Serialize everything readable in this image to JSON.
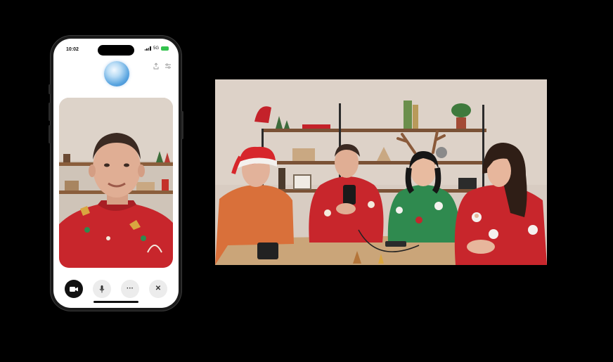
{
  "phone": {
    "status_time": "10:02",
    "network": "5G",
    "icons": {
      "share": "share-icon",
      "settings": "sliders-icon",
      "orb": "assistant-orb-icon"
    },
    "controls": {
      "camera": "video-camera-icon",
      "mic": "microphone-icon",
      "more": "more-icon",
      "more_label": "···",
      "close": "close-icon",
      "close_label": "✕"
    },
    "accent_orb": "#5aa5e0",
    "camera_button_color": "#111111"
  },
  "feed": {
    "description_colors": {
      "wall": "#d8ccc2",
      "table": "#caa579",
      "sweater_red": "#c8262c",
      "sweater_green": "#2f8a4f"
    }
  }
}
